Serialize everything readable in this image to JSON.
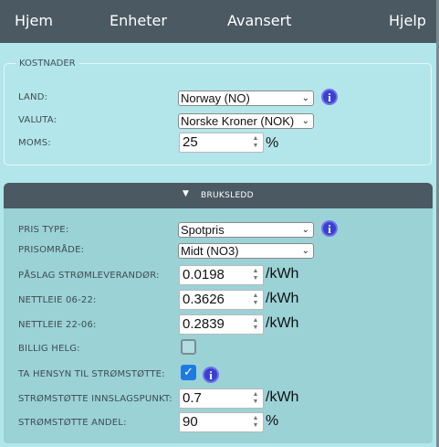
{
  "nav": {
    "home": "Hjem",
    "units": "Enheter",
    "advanced": "Avansert",
    "help": "Hjelp"
  },
  "costs": {
    "legend": "KOSTNADER",
    "country_label": "LAND:",
    "country_value": "Norway (NO)",
    "currency_label": "VALUTA:",
    "currency_value": "Norske Kroner (NOK)",
    "vat_label": "MOMS:",
    "vat_value": "25",
    "vat_unit": "%"
  },
  "usage": {
    "title": "BRUKSLEDD",
    "price_type_label": "PRIS TYPE:",
    "price_type_value": "Spotpris",
    "price_area_label": "PRISOMRÅDE:",
    "price_area_value": "Midt (NO3)",
    "markup_label": "PÅSLAG STRØMLEVERANDØR:",
    "markup_value": "0.0198",
    "grid_day_label": "NETTLEIE 06-22:",
    "grid_day_value": "0.3626",
    "grid_night_label": "NETTLEIE 22-06:",
    "grid_night_value": "0.2839",
    "cheap_weekend_label": "BILLIG HELG:",
    "cheap_weekend_checked": false,
    "support_label": "TA HENSYN TIL STRØMSTØTTE:",
    "support_checked": true,
    "support_threshold_label": "STRØMSTØTTE INNSLAGSPUNKT:",
    "support_threshold_value": "0.7",
    "support_share_label": "STRØMSTØTTE ANDEL:",
    "support_share_value": "90",
    "unit_kwh": "/kWh",
    "unit_pct": "%"
  },
  "icons": {
    "info": "i",
    "chevron": "⌄",
    "check": "✓",
    "triangle": "▼"
  },
  "colors": {
    "nav_bg": "#4b5963",
    "page_bg": "#b3e6ea",
    "section_bg": "#9ad2d6",
    "info": "#3b3fd0",
    "checkbox_on": "#1f7ae0"
  }
}
